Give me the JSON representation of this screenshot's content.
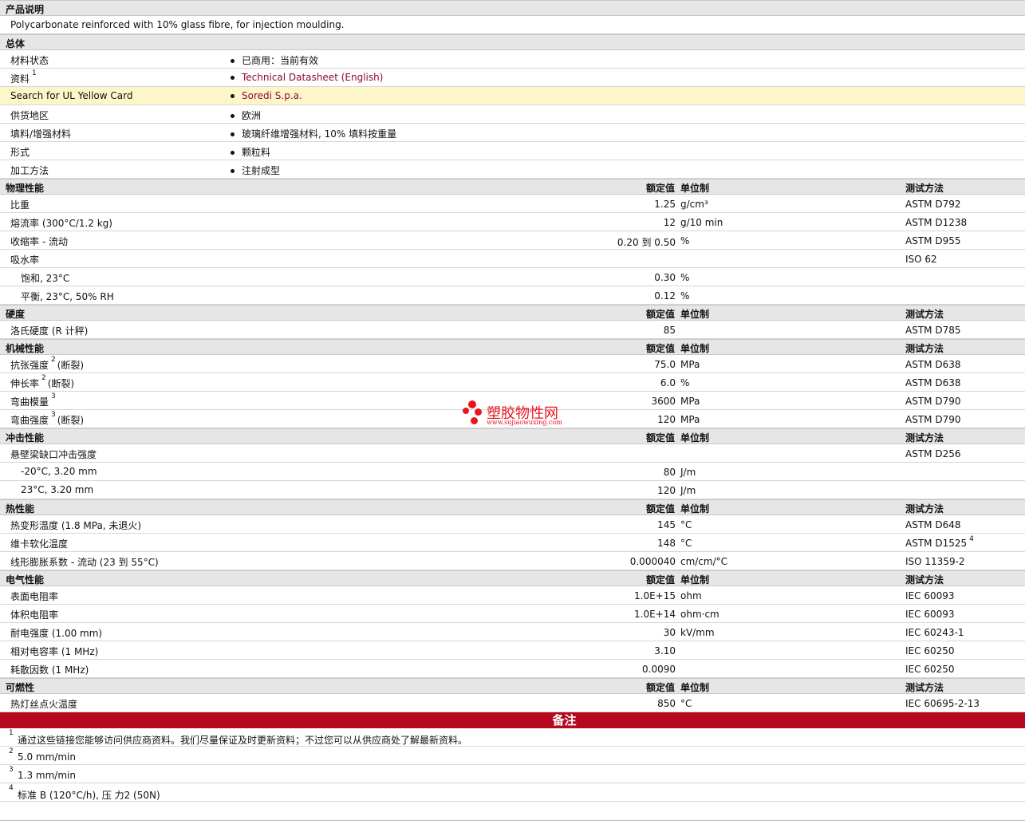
{
  "product": {
    "title": "产品说明",
    "description": "Polycarbonate reinforced with 10% glass fibre, for injection moulding."
  },
  "headers": {
    "value": "额定值",
    "unit": "单位制",
    "method": "测试方法"
  },
  "general": {
    "title": "总体",
    "rows": [
      {
        "label": "材料状态",
        "value": "已商用：当前有效"
      },
      {
        "label": "资料",
        "sup": "1",
        "value": "Technical Datasheet (English)",
        "link": true
      },
      {
        "label": "Search for UL Yellow Card",
        "value": "Soredi S.p.a.",
        "link": true,
        "highlight": true
      },
      {
        "label": "供货地区",
        "value": "欧洲"
      },
      {
        "label": "填料/增强材料",
        "value": "玻璃纤维增强材料, 10% 填料按重量"
      },
      {
        "label": "形式",
        "value": "颗粒料"
      },
      {
        "label": "加工方法",
        "value": "注射成型"
      }
    ]
  },
  "sections": [
    {
      "title": "物理性能",
      "rows": [
        {
          "label": "比重",
          "value": "1.25",
          "unit": "g/cm³",
          "method": "ASTM D792"
        },
        {
          "label": "熔流率  (300°C/1.2 kg)",
          "value": "12",
          "unit": "g/10 min",
          "method": "ASTM D1238"
        },
        {
          "label": "收缩率  - 流动",
          "value": "0.20 到  0.50",
          "unit": "%",
          "method": "ASTM D955"
        },
        {
          "label": "吸水率",
          "method": "ISO 62"
        },
        {
          "label": "饱和, 23°C",
          "indent": true,
          "value": "0.30",
          "unit": "%"
        },
        {
          "label": "平衡, 23°C, 50% RH",
          "indent": true,
          "value": "0.12",
          "unit": "%"
        }
      ]
    },
    {
      "title": "硬度",
      "rows": [
        {
          "label": "洛氏硬度  (R 计秤)",
          "value": "85",
          "method": "ASTM D785"
        }
      ]
    },
    {
      "title": "机械性能",
      "rows": [
        {
          "label": "抗张强度",
          "sup": "2",
          "suffix": "(断裂)",
          "value": "75.0",
          "unit": "MPa",
          "method": "ASTM D638"
        },
        {
          "label": "伸长率",
          "sup": "2",
          "suffix": "(断裂)",
          "value": "6.0",
          "unit": "%",
          "method": "ASTM D638"
        },
        {
          "label": "弯曲模量",
          "sup": "3",
          "value": "3600",
          "unit": "MPa",
          "method": "ASTM D790"
        },
        {
          "label": "弯曲强度",
          "sup": "3",
          "suffix": "(断裂)",
          "value": "120",
          "unit": "MPa",
          "method": "ASTM D790"
        }
      ]
    },
    {
      "title": "冲击性能",
      "rows": [
        {
          "label": "悬壁梁缺口冲击强度",
          "method": "ASTM D256"
        },
        {
          "label": "-20°C, 3.20 mm",
          "indent": true,
          "value": "80",
          "unit": "J/m"
        },
        {
          "label": "23°C, 3.20 mm",
          "indent": true,
          "value": "120",
          "unit": "J/m"
        }
      ]
    },
    {
      "title": "热性能",
      "rows": [
        {
          "label": "热变形温度  (1.8 MPa, 未退火)",
          "value": "145",
          "unit": "°C",
          "method": "ASTM D648"
        },
        {
          "label": "维卡软化温度",
          "value": "148",
          "unit": "°C",
          "method": "ASTM D1525",
          "method_sup": "4"
        },
        {
          "label": "线形膨胀系数  - 流动  (23 到  55°C)",
          "value": "0.000040",
          "unit": "cm/cm/°C",
          "method": "ISO 11359-2"
        }
      ]
    },
    {
      "title": "电气性能",
      "rows": [
        {
          "label": "表面电阻率",
          "value": "1.0E+15",
          "unit": "ohm",
          "method": "IEC 60093"
        },
        {
          "label": "体积电阻率",
          "value": "1.0E+14",
          "unit": "ohm·cm",
          "method": "IEC 60093"
        },
        {
          "label": "耐电强度  (1.00 mm)",
          "value": "30",
          "unit": "kV/mm",
          "method": "IEC 60243-1"
        },
        {
          "label": "相对电容率  (1 MHz)",
          "value": "3.10",
          "method": "IEC 60250"
        },
        {
          "label": "耗散因数  (1 MHz)",
          "value": "0.0090",
          "method": "IEC 60250"
        }
      ]
    },
    {
      "title": "可燃性",
      "rows": [
        {
          "label": "热灯丝点火温度",
          "value": "850",
          "unit": "°C",
          "method": "IEC 60695-2-13"
        }
      ]
    }
  ],
  "notes": {
    "title": "备注",
    "items": [
      {
        "num": "1",
        "text": "通过这些链接您能够访问供应商资料。我们尽量保证及时更新资料；不过您可以从供应商处了解最新资料。"
      },
      {
        "num": "2",
        "text": "5.0 mm/min"
      },
      {
        "num": "3",
        "text": "1.3 mm/min"
      },
      {
        "num": "4",
        "text": "标准  B (120°C/h), 压  力2 (50N)"
      }
    ]
  },
  "watermark": {
    "name": "塑胶物性网",
    "url": "www.sujiaowuxing.com"
  }
}
